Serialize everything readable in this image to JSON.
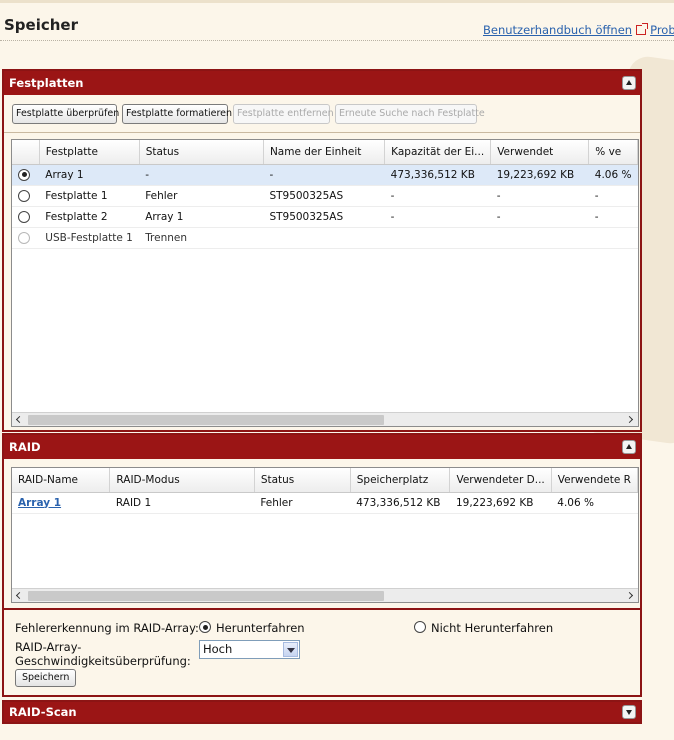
{
  "page": {
    "title": "Speicher",
    "help_link": "Benutzerhandbuch öffnen",
    "trouble_link": "Prob"
  },
  "disks": {
    "title": "Festplatten",
    "buttons": {
      "check": "Festplatte überprüfen",
      "format": "Festplatte formatieren",
      "remove": "Festplatte entfernen",
      "rescan": "Erneute Suche nach Festplatte"
    },
    "columns": [
      "Festplatte",
      "Status",
      "Name der Einheit",
      "Kapazität der Ei...",
      "Verwendet",
      "% ve"
    ],
    "rows": [
      {
        "name": "Array 1",
        "status": "-",
        "unit": "-",
        "capacity": "473,336,512 KB",
        "used": "19,223,692 KB",
        "pct": "4.06 %",
        "selected": true
      },
      {
        "name": "Festplatte 1",
        "status": "Fehler",
        "unit": "ST9500325AS",
        "capacity": "-",
        "used": "-",
        "pct": "-",
        "selected": false
      },
      {
        "name": "Festplatte 2",
        "status": "Array 1",
        "unit": "ST9500325AS",
        "capacity": "-",
        "used": "-",
        "pct": "-",
        "selected": false
      },
      {
        "name": "USB-Festplatte 1",
        "status": "Trennen",
        "unit": "",
        "capacity": "",
        "used": "",
        "pct": "",
        "selected": false
      }
    ]
  },
  "raid": {
    "title": "RAID",
    "columns": [
      "RAID-Name",
      "RAID-Modus",
      "Status",
      "Speicherplatz",
      "Verwendeter D...",
      "Verwendete R"
    ],
    "rows": [
      {
        "name": "Array 1",
        "mode": "RAID 1",
        "status": "Fehler",
        "space": "473,336,512 KB",
        "used": "19,223,692 KB",
        "pct": "4.06 %"
      }
    ],
    "error_detection_label": "Fehlererkennung im RAID-Array:",
    "option_shutdown": "Herunterfahren",
    "option_no_shutdown": "Nicht Herunterfahren",
    "speed_label_line1": "RAID-Array-",
    "speed_label_line2": "Geschwindigkeitsüberprüfung:",
    "speed_value": "Hoch",
    "save": "Speichern"
  },
  "raid_scan": {
    "title": "RAID-Scan"
  }
}
